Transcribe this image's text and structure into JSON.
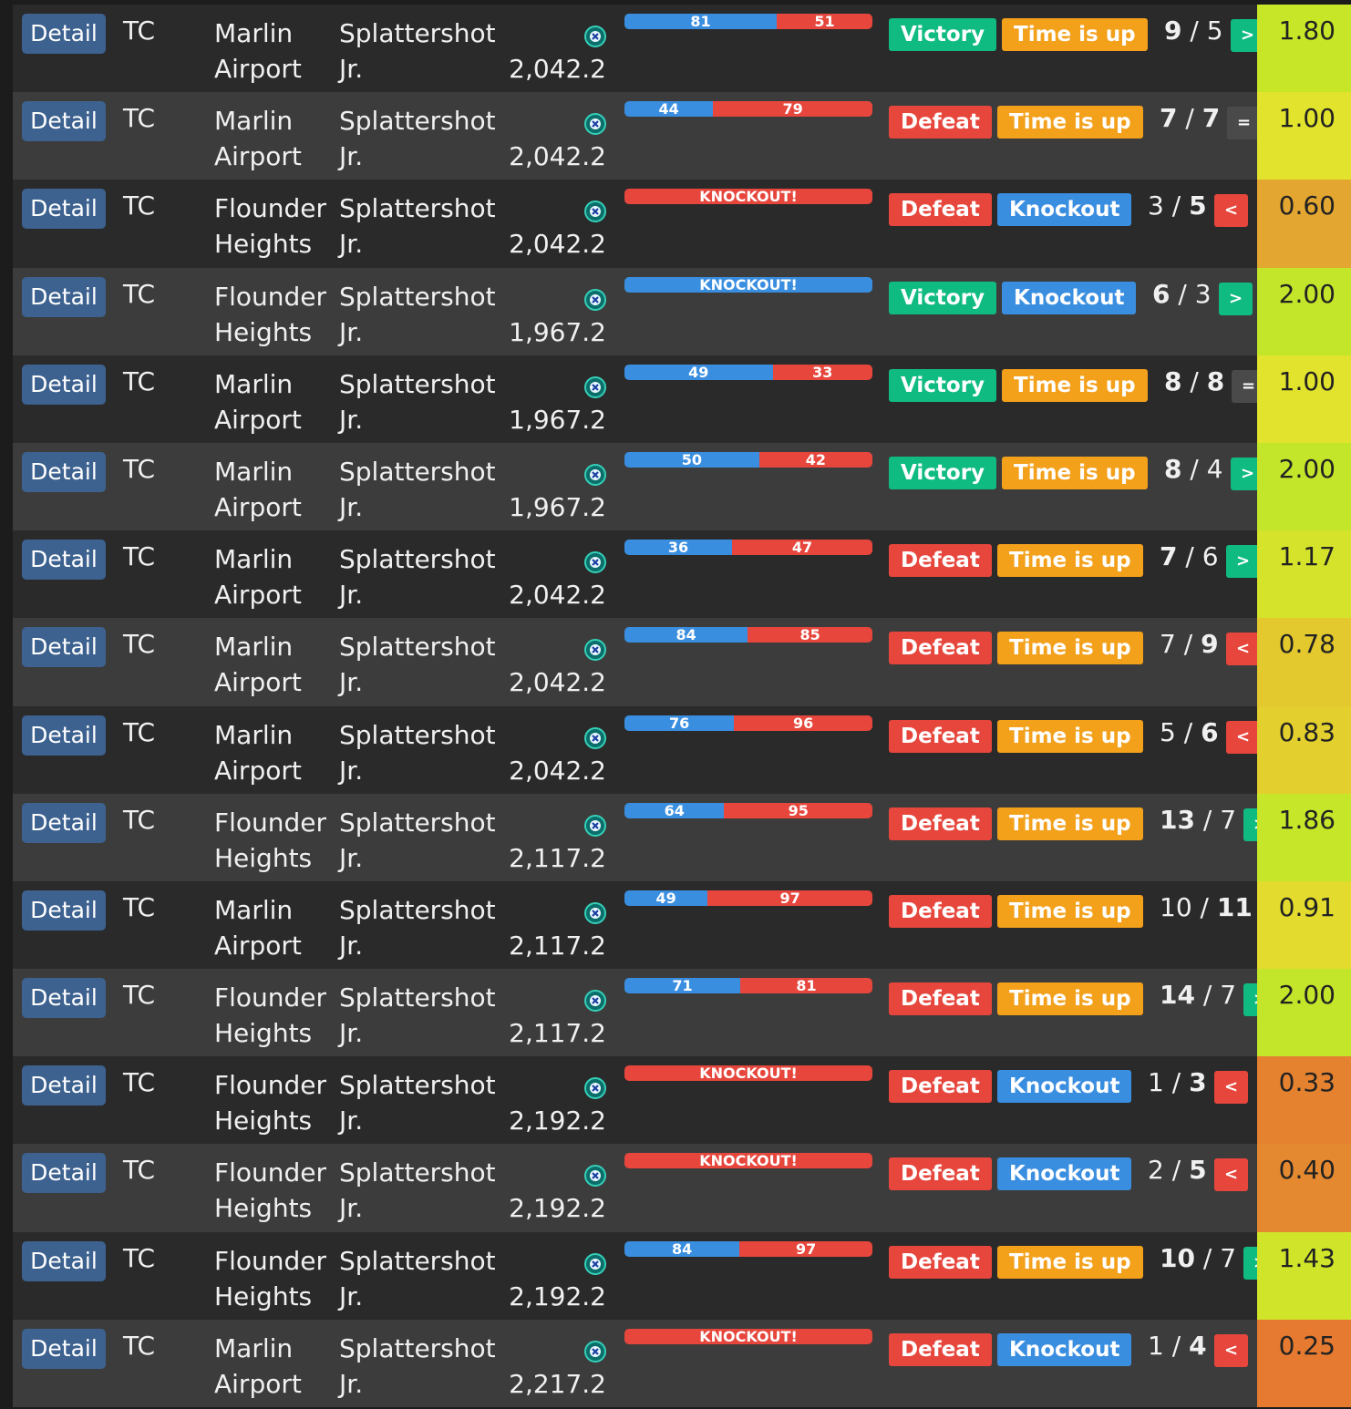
{
  "colors": {
    "victory": "#10bb82",
    "defeat": "#e6463c",
    "time_is_up": "#f3a01b",
    "knockout": "#3a8ee0",
    "detail_button": "#3d6290",
    "ink_blue": "#3a8ee0",
    "ink_red": "#e6463c"
  },
  "icons": {
    "special": "special-weapon-icon"
  },
  "battles": [
    {
      "detail": "Detail",
      "mode": "TC",
      "stage_line1": "Marlin",
      "stage_line2": "Airport",
      "weapon_line1": "Splattershot",
      "weapon_line2": "Jr.",
      "power": "2,042.2",
      "ink_alpha": 81,
      "ink_bravo": 51,
      "knockout": false,
      "ko_text": "",
      "result": "Victory",
      "end": "Time is up",
      "kills": "9",
      "deaths": "5",
      "bold_side": "kills",
      "cmp": ">",
      "ratio": "1.80",
      "ratio_color": "#c8e628"
    },
    {
      "detail": "Detail",
      "mode": "TC",
      "stage_line1": "Marlin",
      "stage_line2": "Airport",
      "weapon_line1": "Splattershot",
      "weapon_line2": "Jr.",
      "power": "2,042.2",
      "ink_alpha": 44,
      "ink_bravo": 79,
      "knockout": false,
      "ko_text": "",
      "result": "Defeat",
      "end": "Time is up",
      "kills": "7",
      "deaths": "7",
      "bold_side": "both",
      "cmp": "=",
      "ratio": "1.00",
      "ratio_color": "#e2e32c"
    },
    {
      "detail": "Detail",
      "mode": "TC",
      "stage_line1": "Flounder",
      "stage_line2": "Heights",
      "weapon_line1": "Splattershot",
      "weapon_line2": "Jr.",
      "power": "2,042.2",
      "ink_alpha": 0,
      "ink_bravo": 100,
      "knockout": true,
      "ko_text": "KNOCKOUT!",
      "result": "Defeat",
      "end": "Knockout",
      "kills": "3",
      "deaths": "5",
      "bold_side": "deaths",
      "cmp": "<",
      "ratio": "0.60",
      "ratio_color": "#e3a630"
    },
    {
      "detail": "Detail",
      "mode": "TC",
      "stage_line1": "Flounder",
      "stage_line2": "Heights",
      "weapon_line1": "Splattershot",
      "weapon_line2": "Jr.",
      "power": "1,967.2",
      "ink_alpha": 100,
      "ink_bravo": 0,
      "knockout": true,
      "ko_text": "KNOCKOUT!",
      "result": "Victory",
      "end": "Knockout",
      "kills": "6",
      "deaths": "3",
      "bold_side": "kills",
      "cmp": ">",
      "ratio": "2.00",
      "ratio_color": "#c3e52a"
    },
    {
      "detail": "Detail",
      "mode": "TC",
      "stage_line1": "Marlin",
      "stage_line2": "Airport",
      "weapon_line1": "Splattershot",
      "weapon_line2": "Jr.",
      "power": "1,967.2",
      "ink_alpha": 49,
      "ink_bravo": 33,
      "knockout": false,
      "ko_text": "",
      "result": "Victory",
      "end": "Time is up",
      "kills": "8",
      "deaths": "8",
      "bold_side": "both",
      "cmp": "=",
      "ratio": "1.00",
      "ratio_color": "#e2e32c"
    },
    {
      "detail": "Detail",
      "mode": "TC",
      "stage_line1": "Marlin",
      "stage_line2": "Airport",
      "weapon_line1": "Splattershot",
      "weapon_line2": "Jr.",
      "power": "1,967.2",
      "ink_alpha": 50,
      "ink_bravo": 42,
      "knockout": false,
      "ko_text": "",
      "result": "Victory",
      "end": "Time is up",
      "kills": "8",
      "deaths": "4",
      "bold_side": "kills",
      "cmp": ">",
      "ratio": "2.00",
      "ratio_color": "#c3e52a"
    },
    {
      "detail": "Detail",
      "mode": "TC",
      "stage_line1": "Marlin",
      "stage_line2": "Airport",
      "weapon_line1": "Splattershot",
      "weapon_line2": "Jr.",
      "power": "2,042.2",
      "ink_alpha": 36,
      "ink_bravo": 47,
      "knockout": false,
      "ko_text": "",
      "result": "Defeat",
      "end": "Time is up",
      "kills": "7",
      "deaths": "6",
      "bold_side": "kills",
      "cmp": ">",
      "ratio": "1.17",
      "ratio_color": "#d5e42b"
    },
    {
      "detail": "Detail",
      "mode": "TC",
      "stage_line1": "Marlin",
      "stage_line2": "Airport",
      "weapon_line1": "Splattershot",
      "weapon_line2": "Jr.",
      "power": "2,042.2",
      "ink_alpha": 84,
      "ink_bravo": 85,
      "knockout": false,
      "ko_text": "",
      "result": "Defeat",
      "end": "Time is up",
      "kills": "7",
      "deaths": "9",
      "bold_side": "deaths",
      "cmp": "<",
      "ratio": "0.78",
      "ratio_color": "#e3c92e"
    },
    {
      "detail": "Detail",
      "mode": "TC",
      "stage_line1": "Marlin",
      "stage_line2": "Airport",
      "weapon_line1": "Splattershot",
      "weapon_line2": "Jr.",
      "power": "2,042.2",
      "ink_alpha": 76,
      "ink_bravo": 96,
      "knockout": false,
      "ko_text": "",
      "result": "Defeat",
      "end": "Time is up",
      "kills": "5",
      "deaths": "6",
      "bold_side": "deaths",
      "cmp": "<",
      "ratio": "0.83",
      "ratio_color": "#e3cf2e"
    },
    {
      "detail": "Detail",
      "mode": "TC",
      "stage_line1": "Flounder",
      "stage_line2": "Heights",
      "weapon_line1": "Splattershot",
      "weapon_line2": "Jr.",
      "power": "2,117.2",
      "ink_alpha": 64,
      "ink_bravo": 95,
      "knockout": false,
      "ko_text": "",
      "result": "Defeat",
      "end": "Time is up",
      "kills": "13",
      "deaths": "7",
      "bold_side": "kills",
      "cmp": ">",
      "ratio": "1.86",
      "ratio_color": "#c6e629"
    },
    {
      "detail": "Detail",
      "mode": "TC",
      "stage_line1": "Marlin",
      "stage_line2": "Airport",
      "weapon_line1": "Splattershot",
      "weapon_line2": "Jr.",
      "power": "2,117.2",
      "ink_alpha": 49,
      "ink_bravo": 97,
      "knockout": false,
      "ko_text": "",
      "result": "Defeat",
      "end": "Time is up",
      "kills": "10",
      "deaths": "11",
      "bold_side": "deaths",
      "cmp": "<",
      "ratio": "0.91",
      "ratio_color": "#e3db2d"
    },
    {
      "detail": "Detail",
      "mode": "TC",
      "stage_line1": "Flounder",
      "stage_line2": "Heights",
      "weapon_line1": "Splattershot",
      "weapon_line2": "Jr.",
      "power": "2,117.2",
      "ink_alpha": 71,
      "ink_bravo": 81,
      "knockout": false,
      "ko_text": "",
      "result": "Defeat",
      "end": "Time is up",
      "kills": "14",
      "deaths": "7",
      "bold_side": "kills",
      "cmp": ">",
      "ratio": "2.00",
      "ratio_color": "#c3e52a"
    },
    {
      "detail": "Detail",
      "mode": "TC",
      "stage_line1": "Flounder",
      "stage_line2": "Heights",
      "weapon_line1": "Splattershot",
      "weapon_line2": "Jr.",
      "power": "2,192.2",
      "ink_alpha": 0,
      "ink_bravo": 100,
      "knockout": true,
      "ko_text": "KNOCKOUT!",
      "result": "Defeat",
      "end": "Knockout",
      "kills": "1",
      "deaths": "3",
      "bold_side": "deaths",
      "cmp": "<",
      "ratio": "0.33",
      "ratio_color": "#e4822f"
    },
    {
      "detail": "Detail",
      "mode": "TC",
      "stage_line1": "Flounder",
      "stage_line2": "Heights",
      "weapon_line1": "Splattershot",
      "weapon_line2": "Jr.",
      "power": "2,192.2",
      "ink_alpha": 0,
      "ink_bravo": 100,
      "knockout": true,
      "ko_text": "KNOCKOUT!",
      "result": "Defeat",
      "end": "Knockout",
      "kills": "2",
      "deaths": "5",
      "bold_side": "deaths",
      "cmp": "<",
      "ratio": "0.40",
      "ratio_color": "#e4892f"
    },
    {
      "detail": "Detail",
      "mode": "TC",
      "stage_line1": "Flounder",
      "stage_line2": "Heights",
      "weapon_line1": "Splattershot",
      "weapon_line2": "Jr.",
      "power": "2,192.2",
      "ink_alpha": 84,
      "ink_bravo": 97,
      "knockout": false,
      "ko_text": "",
      "result": "Defeat",
      "end": "Time is up",
      "kills": "10",
      "deaths": "7",
      "bold_side": "kills",
      "cmp": ">",
      "ratio": "1.43",
      "ratio_color": "#d0e52a"
    },
    {
      "detail": "Detail",
      "mode": "TC",
      "stage_line1": "Marlin",
      "stage_line2": "Airport",
      "weapon_line1": "Splattershot",
      "weapon_line2": "Jr.",
      "power": "2,217.2",
      "ink_alpha": 0,
      "ink_bravo": 100,
      "knockout": true,
      "ko_text": "KNOCKOUT!",
      "result": "Defeat",
      "end": "Knockout",
      "kills": "1",
      "deaths": "4",
      "bold_side": "deaths",
      "cmp": "<",
      "ratio": "0.25",
      "ratio_color": "#e57a30"
    }
  ]
}
